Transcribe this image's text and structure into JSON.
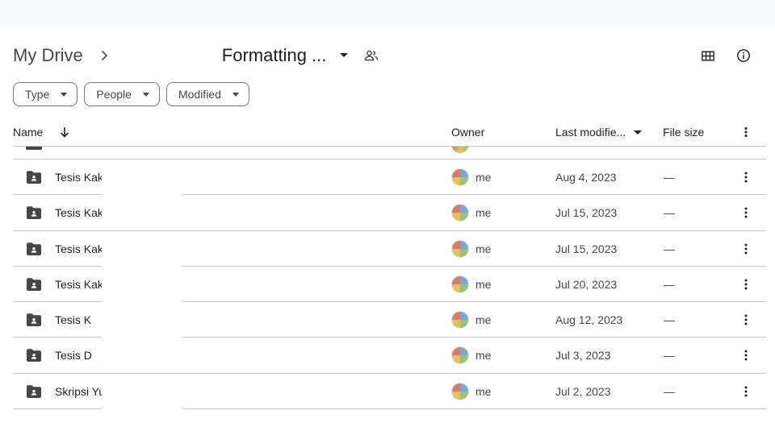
{
  "breadcrumb": {
    "root": "My Drive",
    "current": "Formatting ..."
  },
  "filters": [
    {
      "label": "Type"
    },
    {
      "label": "People"
    },
    {
      "label": "Modified"
    }
  ],
  "columns": {
    "name": "Name",
    "owner": "Owner",
    "last_modified": "Last modifie...",
    "file_size": "File size"
  },
  "rows": [
    {
      "name": "Tesis Kak I",
      "owner": "me",
      "modified": "Aug 4, 2023",
      "size": "—"
    },
    {
      "name": "Tesis Kak I",
      "owner": "me",
      "modified": "Jul 15, 2023",
      "size": "—"
    },
    {
      "name": "Tesis Kak .",
      "owner": "me",
      "modified": "Jul 15, 2023",
      "size": "—"
    },
    {
      "name": "Tesis Kak .",
      "owner": "me",
      "modified": "Jul 20, 2023",
      "size": "—"
    },
    {
      "name": "Tesis K",
      "owner": "me",
      "modified": "Aug 12, 2023",
      "size": "—"
    },
    {
      "name": "Tesis D",
      "owner": "me",
      "modified": "Jul 3, 2023",
      "size": "—"
    },
    {
      "name": "Skripsi Yu",
      "owner": "me",
      "modified": "Jul 2, 2023",
      "size": "—"
    }
  ],
  "icons": {
    "breadcrumb_separator": "chevron-right-icon",
    "current_dropdown": "arrow-drop-down-icon",
    "shared": "people-icon",
    "grid_view": "grid-view-icon",
    "details": "info-icon",
    "sort": "arrow-down-icon",
    "row_type": "shared-folder-icon",
    "row_menu": "more-vert-icon"
  },
  "colors": {
    "icon": "#444746",
    "text": "#1f1f1f",
    "divider": "#c7c7c7",
    "top_strip": "#f8f9fd"
  }
}
